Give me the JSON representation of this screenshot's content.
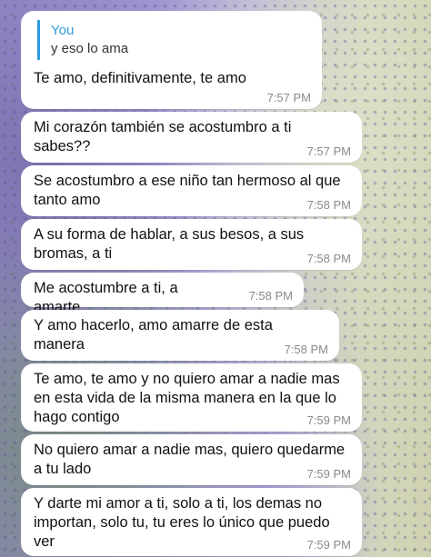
{
  "chat": {
    "reply": {
      "quote_author": "You",
      "quote_text": "y eso lo ama",
      "text": "Te amo, definitivamente, te amo",
      "time": "7:57 PM"
    },
    "messages": [
      {
        "text": "Mi corazón también se acostumbro a ti sabes??",
        "time": "7:57 PM"
      },
      {
        "text": "Se acostumbro a ese niño tan hermoso al que tanto amo",
        "time": "7:58 PM"
      },
      {
        "text": "A su forma de hablar, a sus besos, a sus bromas, a ti",
        "time": "7:58 PM"
      },
      {
        "text": "Me acostumbre a ti, a amarte",
        "time": "7:58 PM"
      },
      {
        "text": "Y amo hacerlo, amo amarre de esta manera",
        "time": "7:58 PM"
      },
      {
        "text": "Te amo, te amo y no quiero amar a nadie mas en esta vida de la misma manera en la que lo hago contigo",
        "time": "7:59 PM"
      },
      {
        "text": "No quiero amar a nadie mas, quiero quedarme a tu lado",
        "time": "7:59 PM"
      },
      {
        "text": "Y darte mi amor a ti, solo a ti, los demas no importan, solo tu, tu eres lo único que puedo ver",
        "time": "7:59 PM"
      }
    ]
  }
}
